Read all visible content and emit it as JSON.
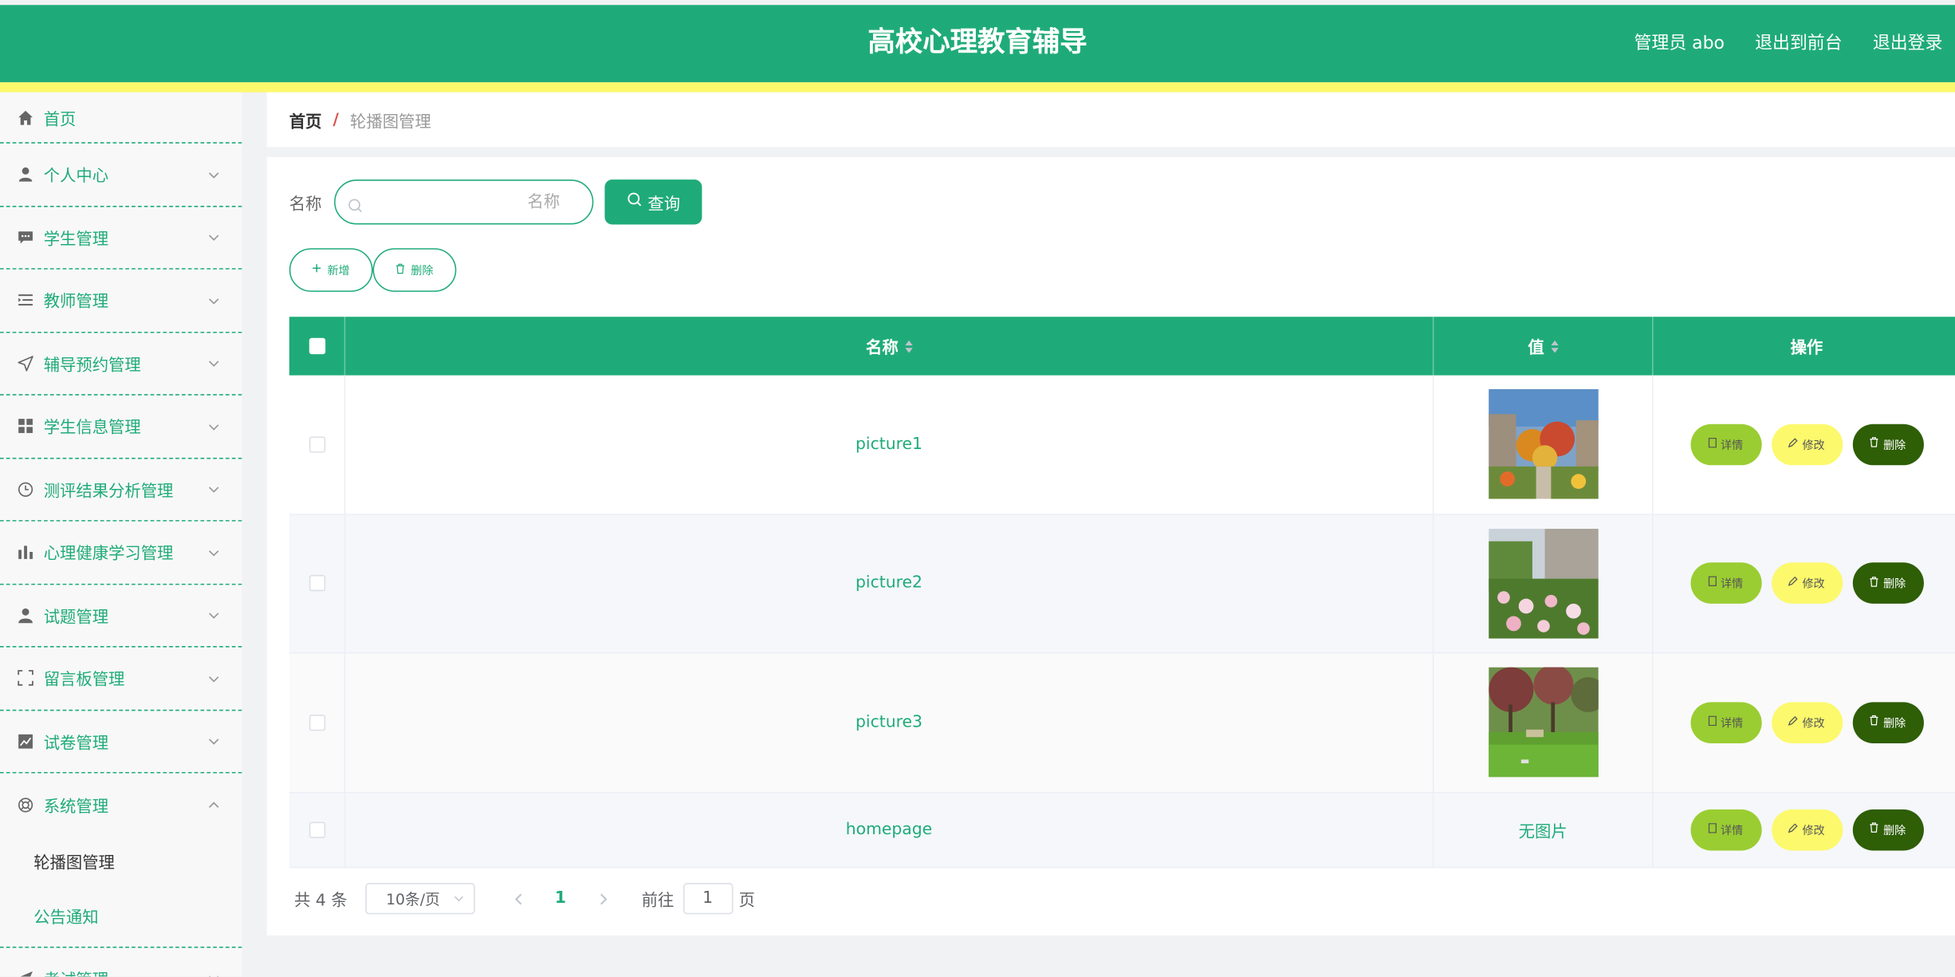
{
  "header": {
    "title": "高校心理教育辅导",
    "user": "管理员 abo",
    "to_front": "退出到前台",
    "logout": "退出登录"
  },
  "sidebar": {
    "items": [
      {
        "label": "首页",
        "icon": "home-icon"
      },
      {
        "label": "个人中心",
        "icon": "user-icon"
      },
      {
        "label": "学生管理",
        "icon": "chat-icon"
      },
      {
        "label": "教师管理",
        "icon": "list-icon"
      },
      {
        "label": "辅导预约管理",
        "icon": "send-icon"
      },
      {
        "label": "学生信息管理",
        "icon": "grid-icon"
      },
      {
        "label": "测评结果分析管理",
        "icon": "clock-icon"
      },
      {
        "label": "心理健康学习管理",
        "icon": "bar-chart-icon"
      },
      {
        "label": "试题管理",
        "icon": "person-icon"
      },
      {
        "label": "留言板管理",
        "icon": "fullscreen-icon"
      },
      {
        "label": "试卷管理",
        "icon": "trend-icon"
      },
      {
        "label": "系统管理",
        "icon": "lifebuoy-icon"
      },
      {
        "label": "考试管理",
        "icon": "send-icon"
      }
    ],
    "sub_items": [
      {
        "label": "轮播图管理"
      },
      {
        "label": "公告通知"
      }
    ]
  },
  "breadcrumb": {
    "home": "首页",
    "separator": "/",
    "current": "轮播图管理"
  },
  "search": {
    "label": "名称",
    "placeholder": "名称",
    "button": "查询"
  },
  "actions": {
    "add": "新增",
    "delete": "删除"
  },
  "table": {
    "headers": {
      "name": "名称",
      "value": "值",
      "operations": "操作"
    },
    "rows": [
      {
        "name": "picture1",
        "value_type": "image"
      },
      {
        "name": "picture2",
        "value_type": "image"
      },
      {
        "name": "picture3",
        "value_type": "image"
      },
      {
        "name": "homepage",
        "value": "无图片"
      }
    ],
    "row_buttons": {
      "detail": "详情",
      "edit": "修改",
      "delete": "删除"
    }
  },
  "pagination": {
    "total": "共 4 条",
    "page_size": "10条/页",
    "current_page": "1",
    "goto_label": "前往",
    "goto_value": "1",
    "page_suffix": "页"
  },
  "colors": {
    "primary": "#1fab79",
    "accent_yellow": "#fcf96c",
    "detail": "#9acd32",
    "delete": "#2e5e06"
  }
}
